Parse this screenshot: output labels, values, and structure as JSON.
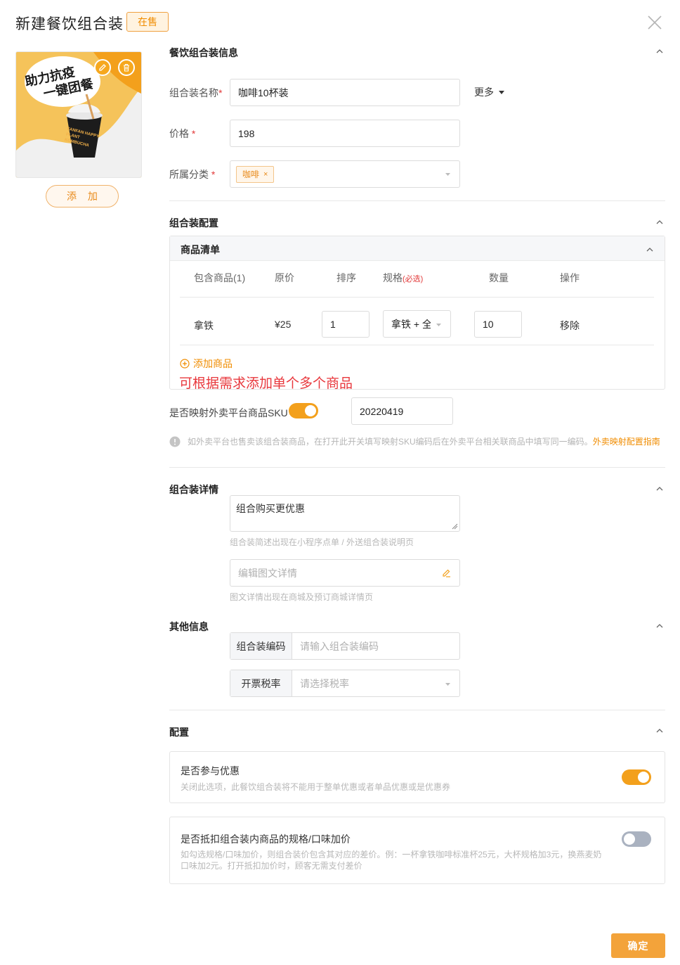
{
  "header": {
    "title": "新建餐饮组合装",
    "status_badge": "在售"
  },
  "image_panel": {
    "poster_line1": "助力抗疫",
    "poster_line2": "一键团餐",
    "cup_text": "FANFAN HAPPY PLANT KOMBUCHA",
    "add_label": "添 加"
  },
  "basic_info": {
    "section_title": "餐饮组合装信息",
    "name_label": "组合装名称",
    "name_value": "咖啡10杯装",
    "more_label": "更多",
    "price_label": "价格",
    "price_value": "198",
    "category_label": "所属分类",
    "category_tag": "咖啡",
    "required_mark": "*"
  },
  "combo_config": {
    "section_title": "组合装配置",
    "list_title": "商品清单",
    "columns": {
      "product": "包含商品(1)",
      "price": "原价",
      "sort": "排序",
      "spec": "规格",
      "spec_required": "(必选)",
      "qty": "数量",
      "action": "操作"
    },
    "rows": [
      {
        "name": "拿铁",
        "price": "¥25",
        "sort": "1",
        "spec": "拿铁 + 全",
        "qty": "10",
        "action": "移除"
      }
    ],
    "add_product": "添加商品",
    "hint": "可根据需求添加单个多个商品",
    "sku_label": "是否映射外卖平台商品SKU",
    "sku_value": "20220419",
    "sku_enabled": true,
    "sku_tip": "如外卖平台也售卖该组合装商品，在打开此开关填写映射SKU编码后在外卖平台相关联商品中填写同一编码。",
    "sku_link": "外卖映射配置指南"
  },
  "details": {
    "section_title": "组合装详情",
    "desc_value": "组合购买更优惠",
    "desc_hint": "组合装简述出现在小程序点单 / 外送组合装说明页",
    "rich_placeholder": "编辑图文详情",
    "rich_hint": "图文详情出现在商城及预订商城详情页"
  },
  "other": {
    "section_title": "其他信息",
    "code_label": "组合装编码",
    "code_placeholder": "请输入组合装编码",
    "tax_label": "开票税率",
    "tax_placeholder": "请选择税率"
  },
  "config": {
    "section_title": "配置",
    "discount_title": "是否参与优惠",
    "discount_desc": "关闭此选项，此餐饮组合装将不能用于整单优惠或者单品优惠或是优惠券",
    "discount_enabled": true,
    "offset_title": "是否抵扣组合装内商品的规格/口味加价",
    "offset_desc": "如勾选规格/口味加价，则组合装价包含其对应的差价。例：一杯拿铁咖啡标准杯25元，大杯规格加3元，换燕麦奶口味加2元。打开抵扣加价时，顾客无需支付差价",
    "offset_enabled": false
  },
  "footer": {
    "confirm_label": "确定"
  },
  "colors": {
    "accent": "#f3a01c",
    "danger": "#e23a3a",
    "hint_red": "#e8383d"
  }
}
